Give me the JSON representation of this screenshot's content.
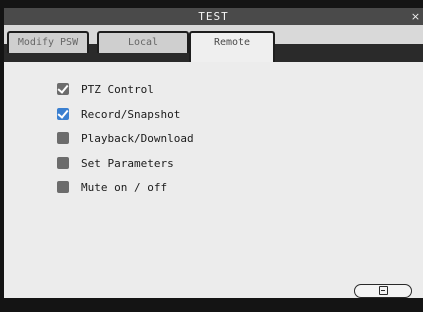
{
  "window": {
    "title": "TEST"
  },
  "tabs": [
    {
      "label": "Modify PSW",
      "active": false
    },
    {
      "label": "Local",
      "active": false
    },
    {
      "label": "Remote",
      "active": true
    }
  ],
  "permissions": [
    {
      "label": "PTZ Control",
      "checked": true
    },
    {
      "label": "Record/Snapshot",
      "checked": true
    },
    {
      "label": "Playback/Download",
      "checked": false
    },
    {
      "label": "Set Parameters",
      "checked": false
    },
    {
      "label": "Mute on / off",
      "checked": false
    }
  ],
  "icons": {
    "close": "close-icon",
    "save": "floppy-disk-icon"
  },
  "colors": {
    "title_bar": "#4a4a4a",
    "checkbox_focus": "#3a7fd0",
    "checkbox": "#6c6c6c"
  }
}
